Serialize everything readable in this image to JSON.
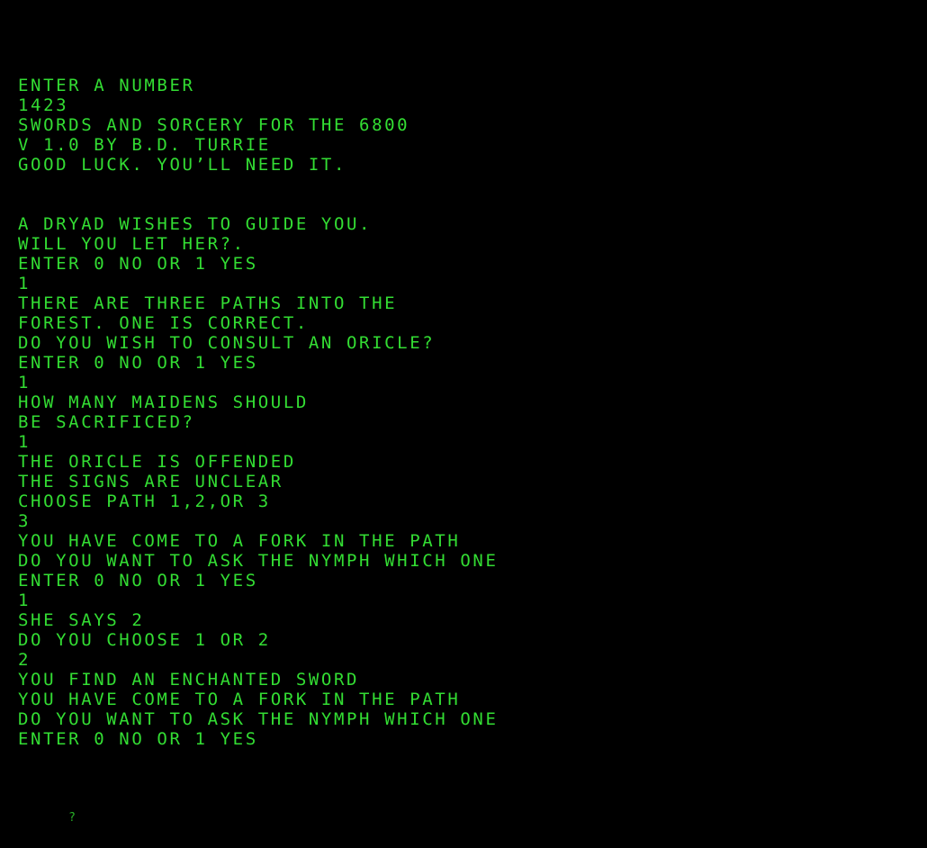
{
  "terminal": {
    "lines": [
      "ENTER A NUMBER",
      "1423",
      "SWORDS AND SORCERY FOR THE 6800",
      "V 1.0 BY B.D. TURRIE",
      "GOOD LUCK. YOU’LL NEED IT.",
      "",
      "",
      "A DRYAD WISHES TO GUIDE YOU.",
      "WILL YOU LET HER?.",
      "ENTER 0 NO OR 1 YES",
      "1",
      "THERE ARE THREE PATHS INTO THE",
      "FOREST. ONE IS CORRECT.",
      "DO YOU WISH TO CONSULT AN ORICLE?",
      "ENTER 0 NO OR 1 YES",
      "1",
      "HOW MANY MAIDENS SHOULD",
      "BE SACRIFICED?",
      "1",
      "THE ORICLE IS OFFENDED",
      "THE SIGNS ARE UNCLEAR",
      "CHOOSE PATH 1,2,OR 3",
      "3",
      "YOU HAVE COME TO A FORK IN THE PATH",
      "DO YOU WANT TO ASK THE NYMPH WHICH ONE",
      "ENTER 0 NO OR 1 YES",
      "1",
      "SHE SAYS 2",
      "DO YOU CHOOSE 1 OR 2",
      "2",
      "YOU FIND AN ENCHANTED SWORD",
      "YOU HAVE COME TO A FORK IN THE PATH",
      "DO YOU WANT TO ASK THE NYMPH WHICH ONE",
      "ENTER 0 NO OR 1 YES"
    ],
    "prompt_char": "?"
  },
  "colors": {
    "background": "#000000",
    "text": "#33dd33"
  }
}
